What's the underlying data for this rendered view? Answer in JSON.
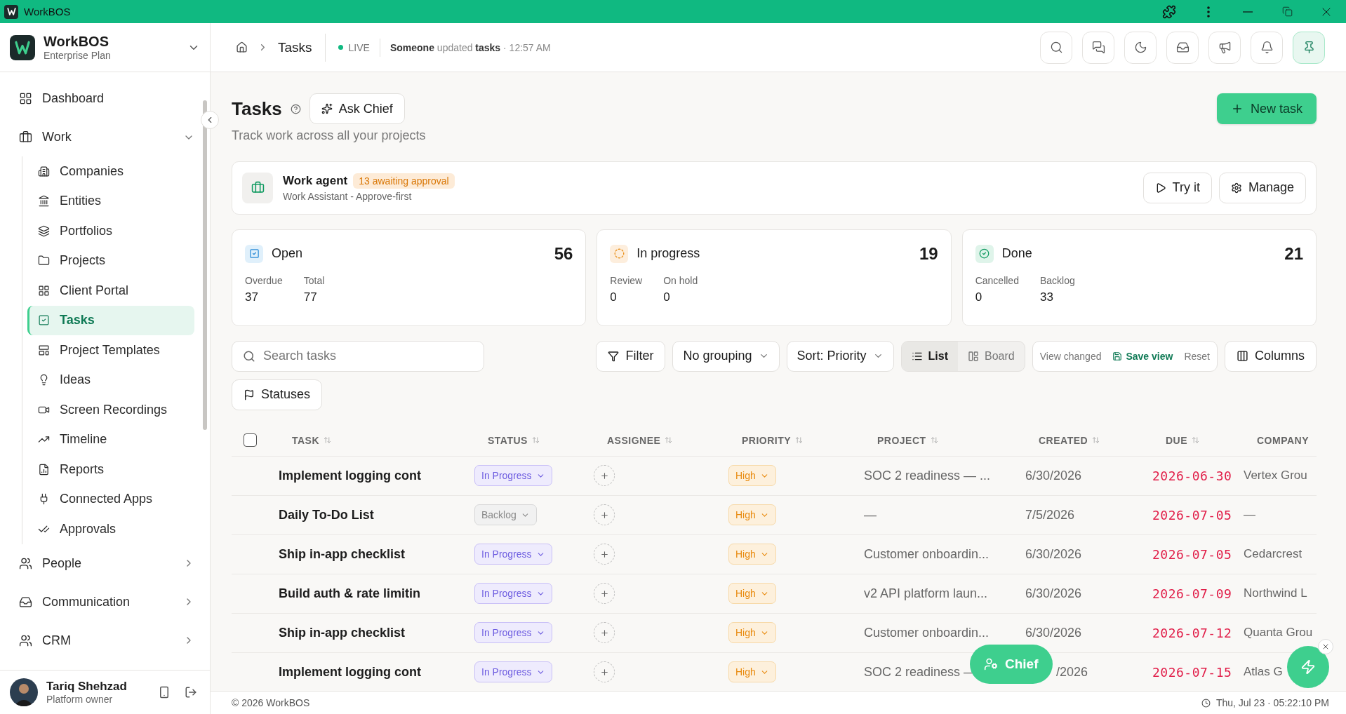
{
  "titlebar": {
    "title": "WorkBOS"
  },
  "sidebar": {
    "brand": {
      "name": "WorkBOS",
      "plan": "Enterprise Plan"
    },
    "nav": [
      {
        "label": "Dashboard",
        "selected": false
      },
      {
        "label": "Work",
        "selected": false,
        "expanded": true,
        "children": [
          {
            "label": "Companies",
            "selected": false
          },
          {
            "label": "Entities",
            "selected": false
          },
          {
            "label": "Portfolios",
            "selected": false
          },
          {
            "label": "Projects",
            "selected": false
          },
          {
            "label": "Client Portal",
            "selected": false
          },
          {
            "label": "Tasks",
            "selected": true
          },
          {
            "label": "Project Templates",
            "selected": false
          },
          {
            "label": "Ideas",
            "selected": false
          },
          {
            "label": "Screen Recordings",
            "selected": false
          },
          {
            "label": "Timeline",
            "selected": false
          },
          {
            "label": "Reports",
            "selected": false
          },
          {
            "label": "Connected Apps",
            "selected": false
          },
          {
            "label": "Approvals",
            "selected": false
          }
        ]
      },
      {
        "label": "People",
        "selected": false,
        "expanded": false
      },
      {
        "label": "Communication",
        "selected": false,
        "expanded": false
      },
      {
        "label": "CRM",
        "selected": false,
        "expanded": false
      }
    ],
    "user": {
      "name": "Tariq Shehzad",
      "role": "Platform owner"
    }
  },
  "header": {
    "breadcrumb": "Tasks",
    "live": "LIVE",
    "activity": "**Someone** updated **tasks** · 12:57 AM"
  },
  "page": {
    "title": "Tasks",
    "ask_button": "Ask Chief",
    "subtitle": "Track work across all your projects",
    "new_button": "New task"
  },
  "agent": {
    "name": "Work agent",
    "badge": "13 awaiting approval",
    "subtitle": "Work Assistant - Approve-first",
    "buttons": [
      "Try it",
      "Manage"
    ]
  },
  "stats": [
    {
      "label": "Open",
      "value": "56",
      "details": [
        {
          "label": "Overdue",
          "value": "37"
        },
        {
          "label": "Total",
          "value": "77"
        }
      ]
    },
    {
      "label": "In progress",
      "value": "19",
      "details": [
        {
          "label": "Review",
          "value": "0"
        },
        {
          "label": "On hold",
          "value": "0"
        }
      ]
    },
    {
      "label": "Done",
      "value": "21",
      "details": [
        {
          "label": "Cancelled",
          "value": "0"
        },
        {
          "label": "Backlog",
          "value": "33"
        }
      ]
    }
  ],
  "toolbar": {
    "search": {
      "placeholder": "Search tasks"
    },
    "filter": "Filter",
    "grouping": "No grouping",
    "sort": "Sort: Priority",
    "views": [
      {
        "label": "List",
        "selected": true
      },
      {
        "label": "Board",
        "selected": false
      }
    ],
    "view_changed": "View changed",
    "save": "Save view",
    "reset": "Reset",
    "columns": "Columns",
    "statuses": "Statuses"
  },
  "table": {
    "select_all": false,
    "columns": [
      "TASK",
      "STATUS",
      "ASSIGNEE",
      "PRIORITY",
      "PROJECT",
      "CREATED",
      "DUE",
      "COMPANY"
    ],
    "rows": [
      {
        "task": "Implement logging cont",
        "status": {
          "label": "In Progress",
          "kind": "progress"
        },
        "priority": "High",
        "project": "SOC 2 readiness — ...",
        "created": "6/30/2026",
        "due": "2026-06-30",
        "company": "Vertex Grou"
      },
      {
        "task": "Daily To-Do List",
        "status": {
          "label": "Backlog",
          "kind": "backlog"
        },
        "priority": "High",
        "project": "—",
        "created": "7/5/2026",
        "due": "2026-07-05",
        "company": "—"
      },
      {
        "task": "Ship in-app checklist",
        "status": {
          "label": "In Progress",
          "kind": "progress"
        },
        "priority": "High",
        "project": "Customer onboardin...",
        "created": "6/30/2026",
        "due": "2026-07-05",
        "company": "Cedarcrest"
      },
      {
        "task": "Build auth & rate limitin",
        "status": {
          "label": "In Progress",
          "kind": "progress"
        },
        "priority": "High",
        "project": "v2 API platform laun...",
        "created": "6/30/2026",
        "due": "2026-07-09",
        "company": "Northwind L"
      },
      {
        "task": "Ship in-app checklist",
        "status": {
          "label": "In Progress",
          "kind": "progress"
        },
        "priority": "High",
        "project": "Customer onboardin...",
        "created": "6/30/2026",
        "due": "2026-07-12",
        "company": "Quanta Grou"
      },
      {
        "task": "Implement logging cont",
        "status": {
          "label": "In Progress",
          "kind": "progress"
        },
        "priority": "High",
        "project": "SOC 2 readiness —",
        "created": "/2026",
        "due": "2026-07-15",
        "company": "Atlas G"
      }
    ]
  },
  "chief_button": "Chief",
  "footer": {
    "copyright": "© 2026 WorkBOS",
    "datetime": "Thu, Jul 23 · 05:22:10 PM"
  }
}
